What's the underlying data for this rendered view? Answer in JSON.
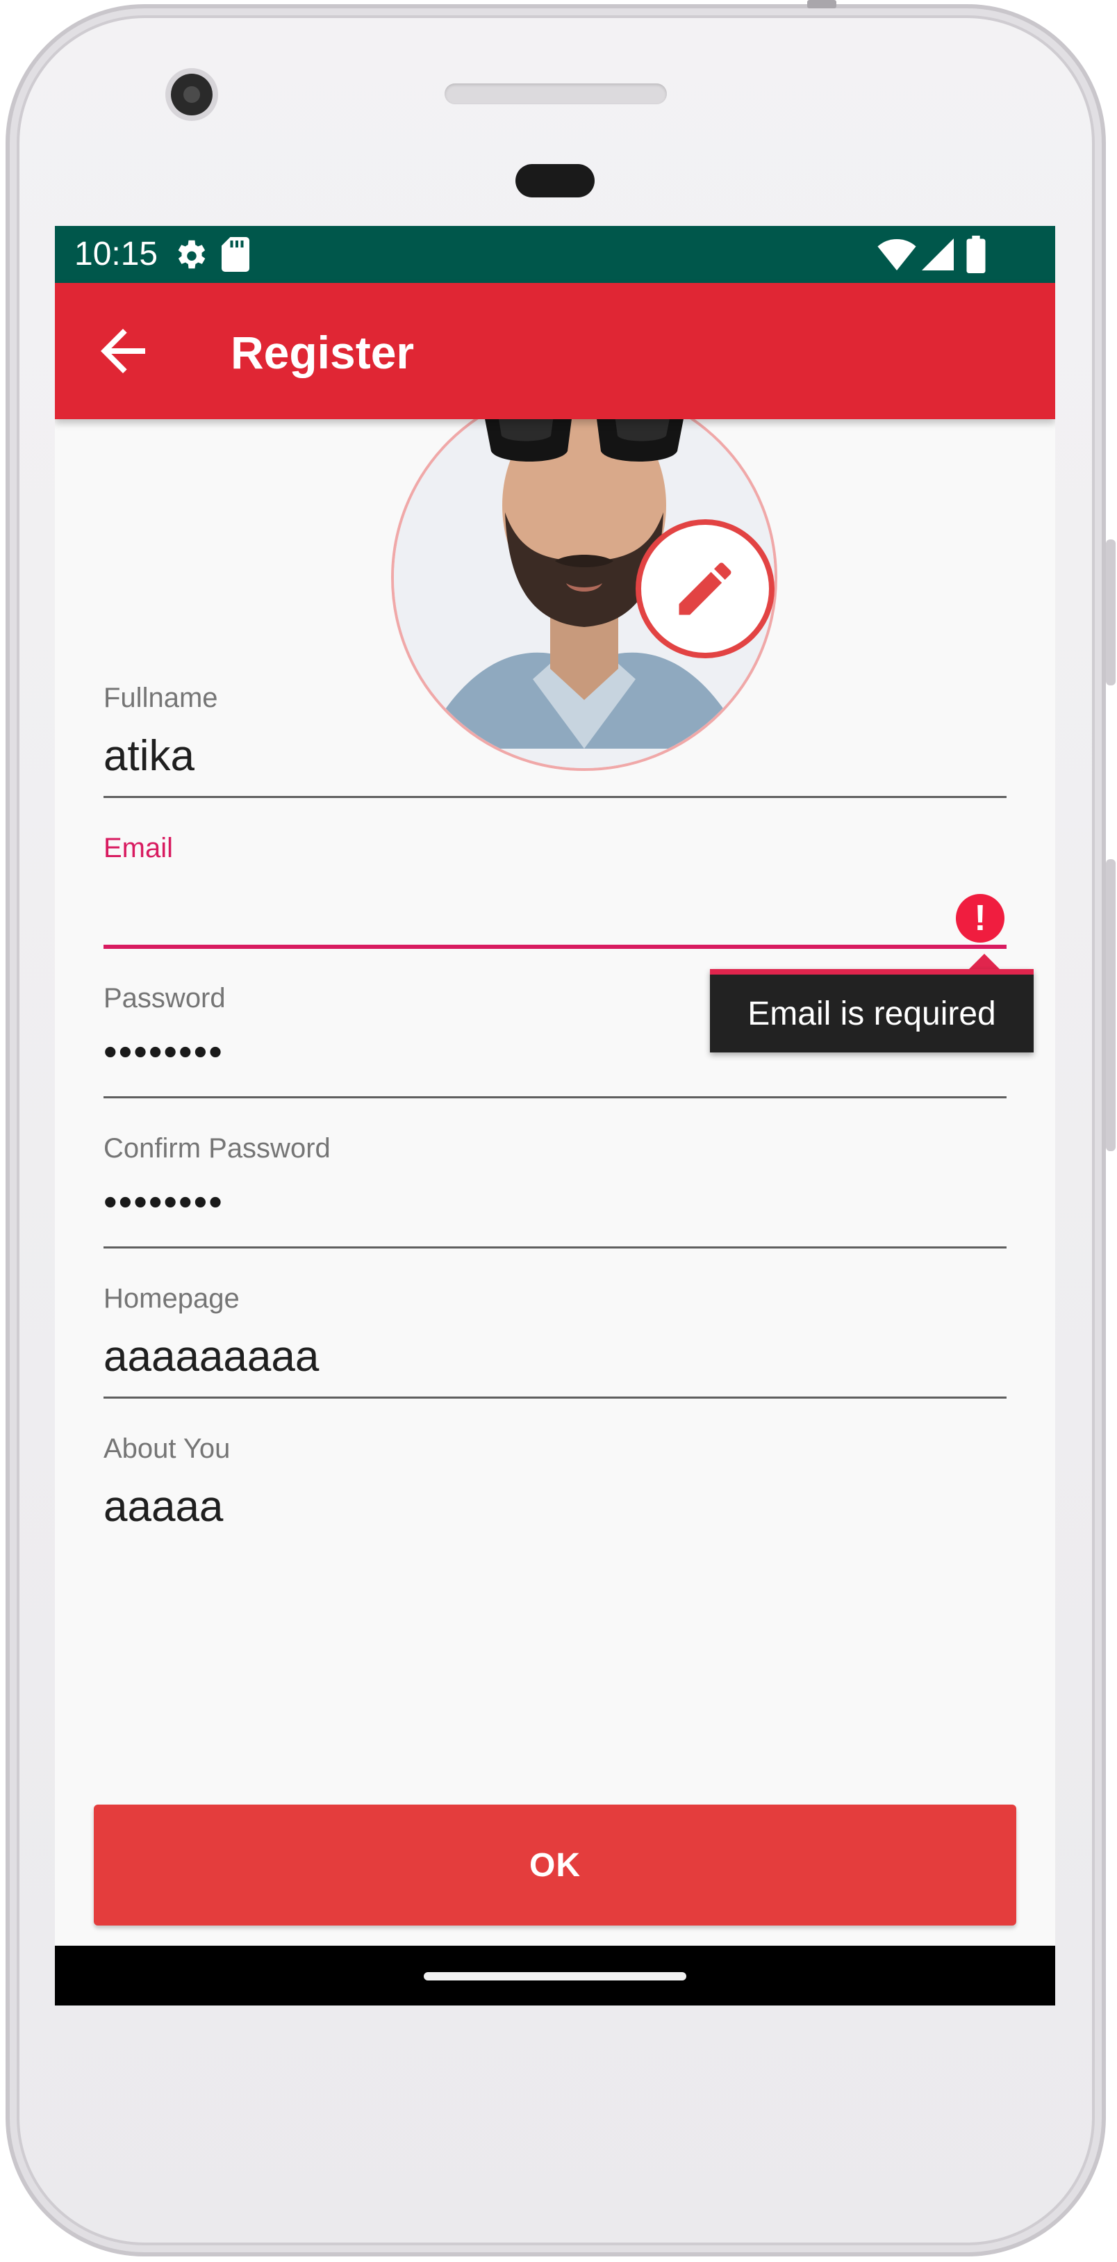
{
  "status_bar": {
    "time": "10:15",
    "icons": [
      "settings-gear-icon",
      "sd-card-icon",
      "wifi-icon",
      "signal-icon",
      "battery-icon"
    ]
  },
  "app_bar": {
    "title": "Register",
    "back_icon": "arrow-back-icon"
  },
  "avatar": {
    "edit_icon": "pencil-icon"
  },
  "form": {
    "fullname": {
      "label": "Fullname",
      "value": "atika"
    },
    "email": {
      "label": "Email",
      "value": "",
      "error": "Email is required"
    },
    "password": {
      "label": "Password",
      "value": "••••••••"
    },
    "confirm_password": {
      "label": "Confirm Password",
      "value": "••••••••"
    },
    "homepage": {
      "label": "Homepage",
      "value": "aaaaaaaaa"
    },
    "about": {
      "label": "About You",
      "value": "aaaaa"
    }
  },
  "actions": {
    "ok_label": "OK"
  },
  "colors": {
    "status_bar": "#00574b",
    "app_bar": "#e02634",
    "accent_error": "#d81b60",
    "button": "#e43d3d"
  }
}
